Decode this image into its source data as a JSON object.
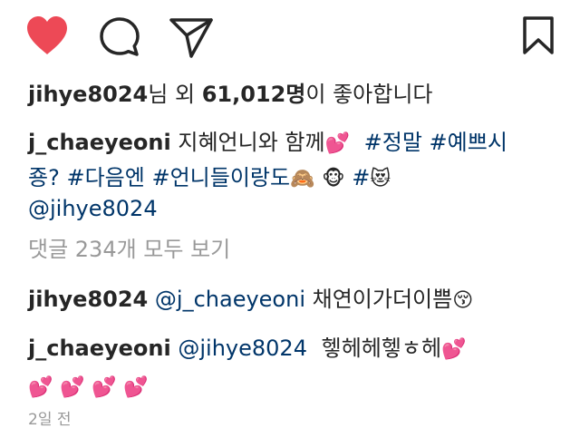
{
  "actions": {
    "like_icon": "heart-filled-icon",
    "comment_icon": "comment-bubble-icon",
    "share_icon": "paper-plane-icon",
    "save_icon": "bookmark-icon",
    "like_color": "#ed4956"
  },
  "likes": {
    "username": "jihye8024",
    "text_1": "님 외 ",
    "count": "61,012명",
    "text_2": "이 좋아합니다"
  },
  "caption": {
    "username": "j_chaeyeoni",
    "text": "지혜언니와 함께",
    "emoji_1": "💕",
    "tag_1": "#정말",
    "tag_2": "#예쁘시",
    "tag_2_cont": "죵?",
    "tag_3": "#다음엔",
    "tag_4": "#언니들이랑도",
    "emoji_2": "🙈",
    "emoji_3": "🐵",
    "tag_5": "#",
    "emoji_4": "😻",
    "mention": "@jihye8024"
  },
  "view_all": "댓글 234개 모두 보기",
  "comments": [
    {
      "username": "jihye8024",
      "mention": "@j_chaeyeoni",
      "text": "채연이가더이쁨",
      "emoji": "😚"
    },
    {
      "username": "j_chaeyeoni",
      "mention": "@jihye8024",
      "text": "헿헤헤헿ㅎ헤",
      "emoji": "💕",
      "emoji_row": [
        "💕",
        "💕",
        "💕",
        "💕"
      ]
    }
  ],
  "timestamp": "2일 전"
}
